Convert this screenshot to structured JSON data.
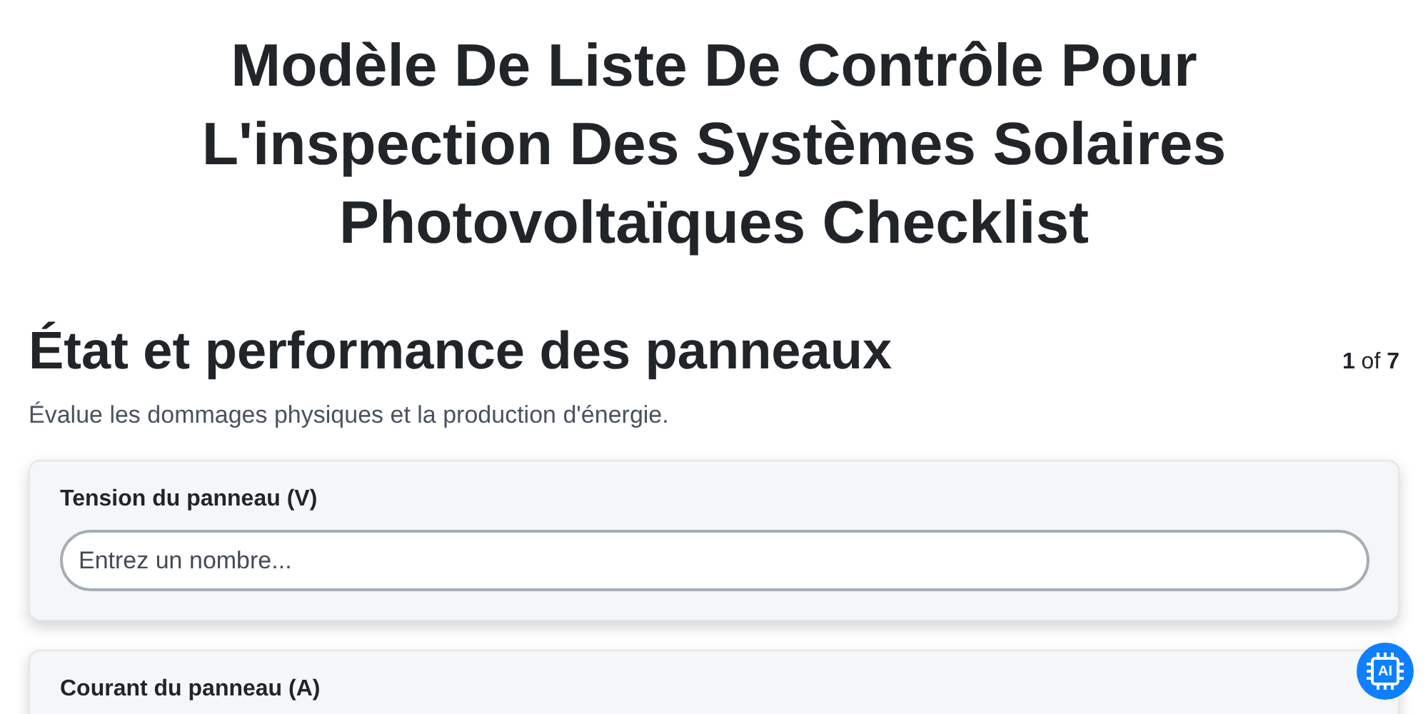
{
  "title": "Modèle De Liste De Contrôle Pour L'inspection Des Systèmes Solaires Photovoltaïques Checklist",
  "section": {
    "heading": "État et performance des panneaux",
    "page": "1",
    "of": "of",
    "total": "7",
    "description": "Évalue les dommages physiques et la production d'énergie."
  },
  "fields": [
    {
      "label": "Tension du panneau (V)",
      "placeholder": "Entrez un nombre..."
    },
    {
      "label": "Courant du panneau (A)"
    }
  ],
  "assistant_button": {
    "label": "AI"
  }
}
